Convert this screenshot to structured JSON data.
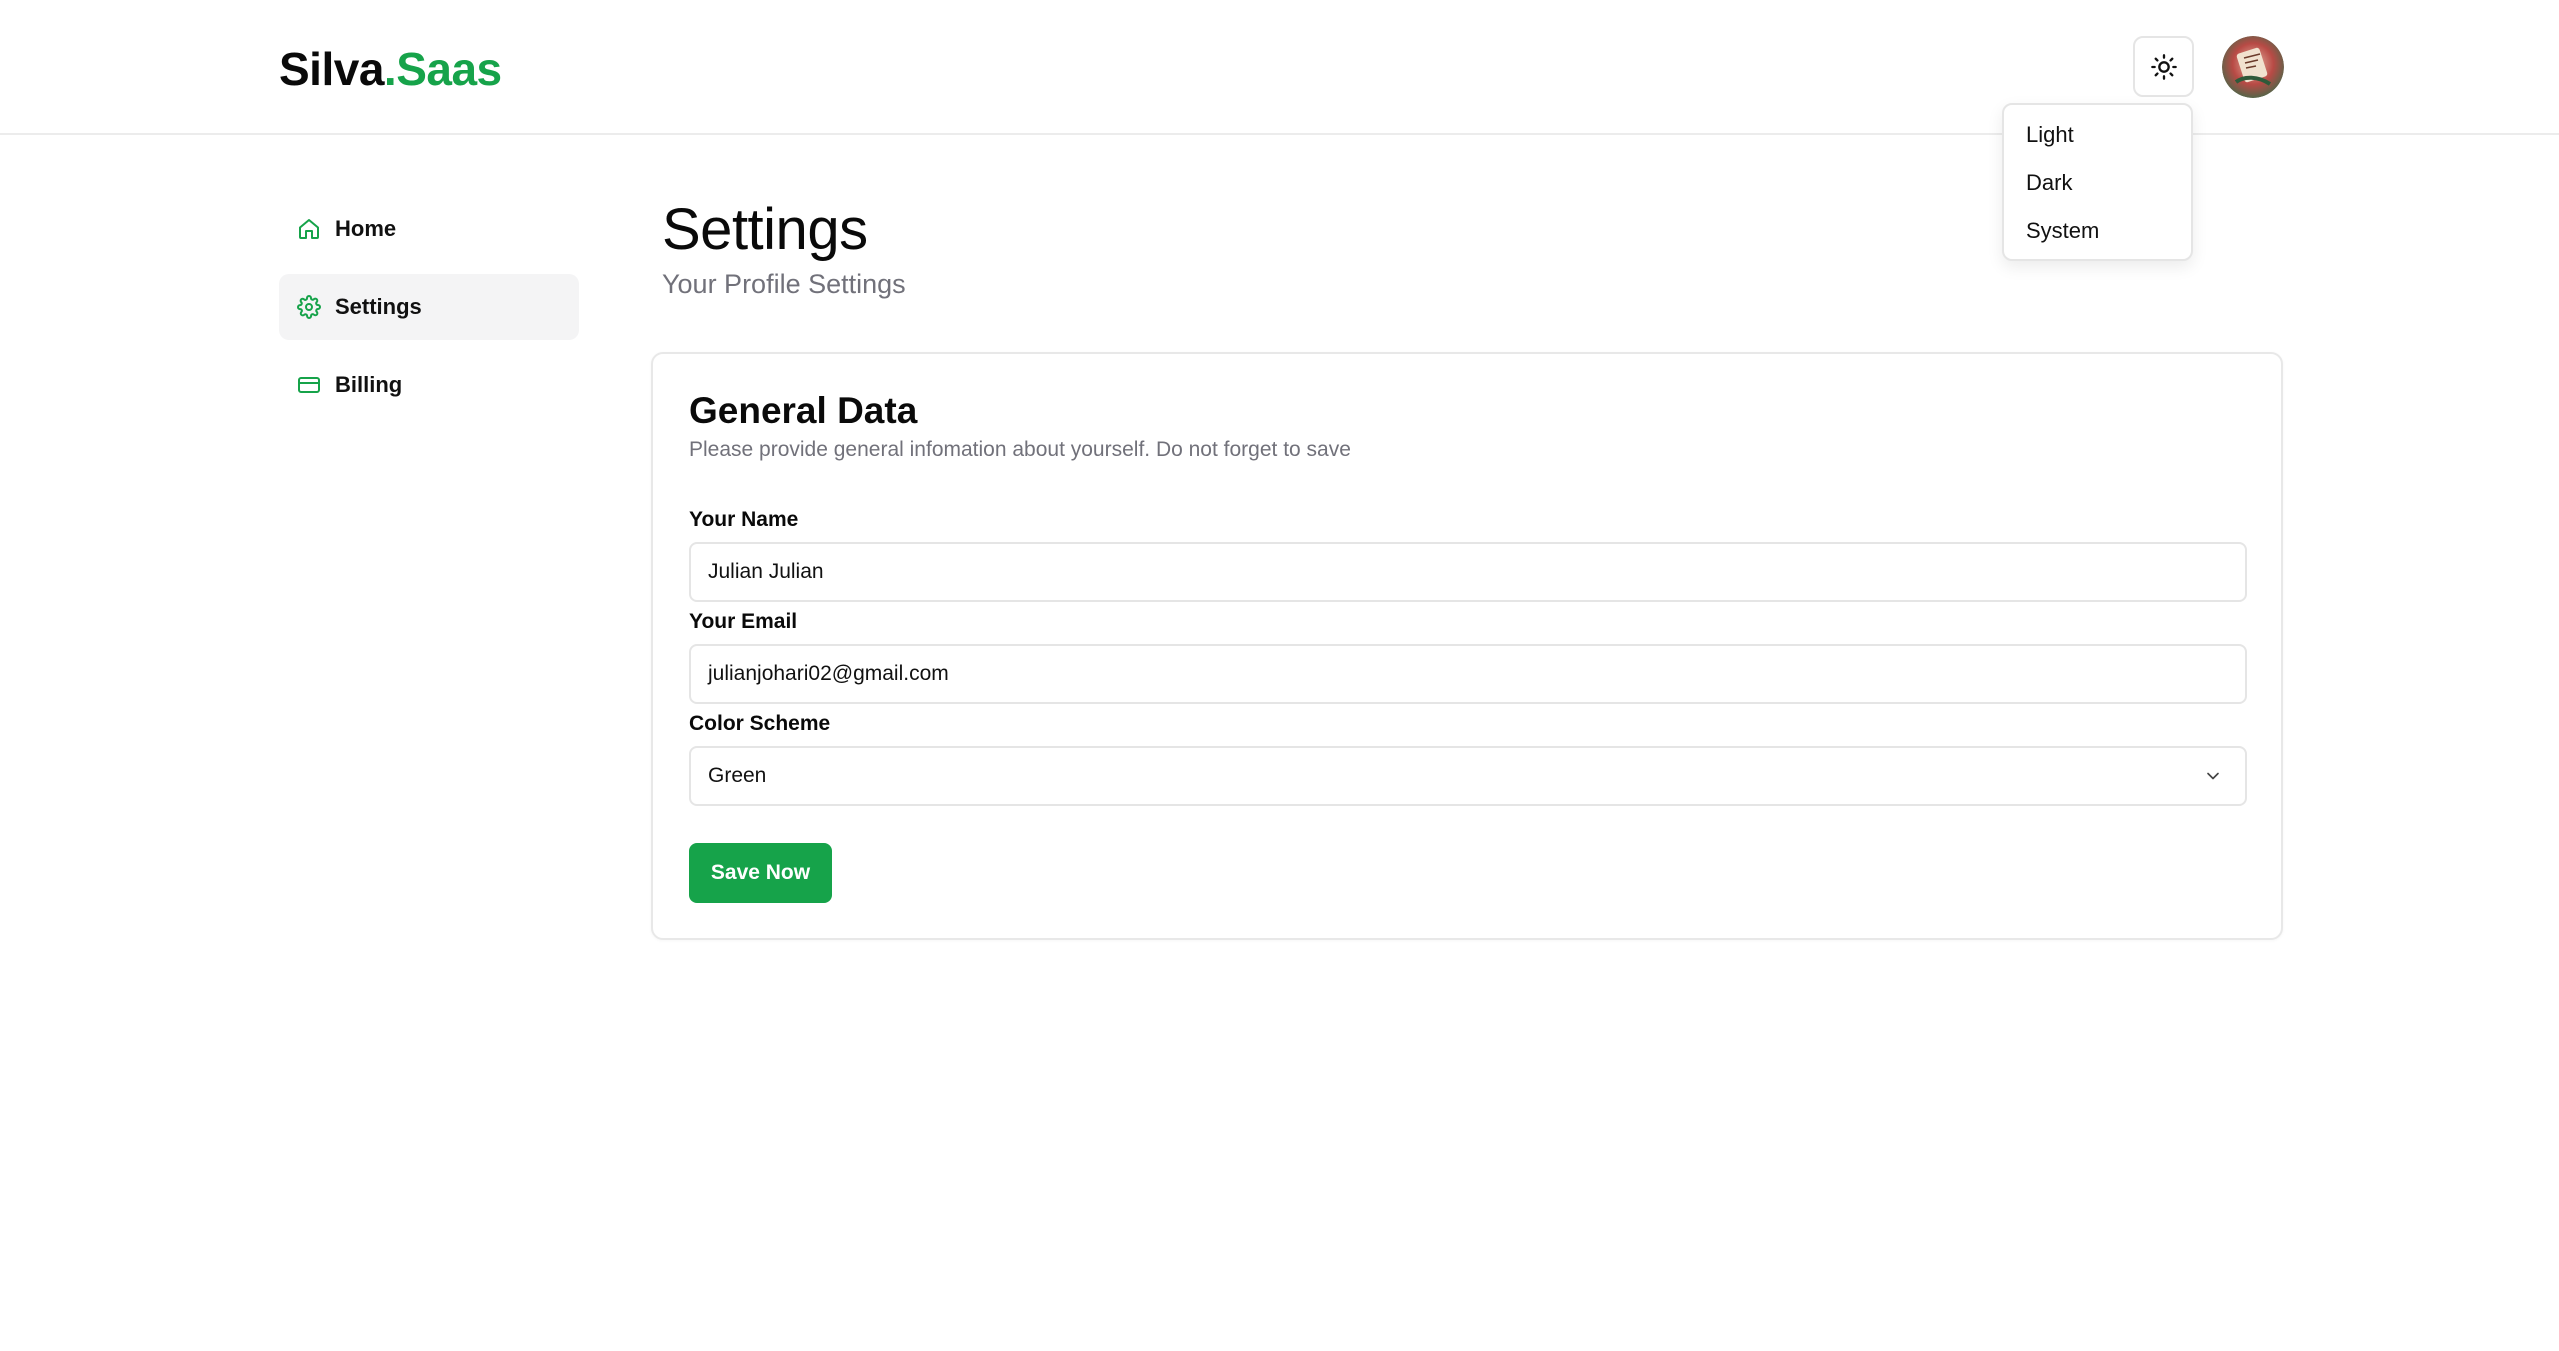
{
  "header": {
    "logo_primary": "Silva",
    "logo_accent": ".Saas",
    "theme_button_icon": "sun-icon",
    "avatar_alt": "avatar"
  },
  "theme_menu": {
    "items": [
      {
        "label": "Light"
      },
      {
        "label": "Dark"
      },
      {
        "label": "System"
      }
    ]
  },
  "sidebar": {
    "items": [
      {
        "label": "Home",
        "icon": "home-icon",
        "active": false
      },
      {
        "label": "Settings",
        "icon": "gear-icon",
        "active": true
      },
      {
        "label": "Billing",
        "icon": "credit-card-icon",
        "active": false
      }
    ]
  },
  "page": {
    "title": "Settings",
    "subtitle": "Your Profile Settings"
  },
  "card": {
    "title": "General Data",
    "description": "Please provide general infomation about yourself. Do not forget to save",
    "name_label": "Your Name",
    "name_value": "Julian Julian",
    "email_label": "Your Email",
    "email_value": "julianjohari02@gmail.com",
    "color_label": "Color Scheme",
    "color_value": "Green",
    "save_label": "Save Now"
  },
  "colors": {
    "accent": "#16a34a",
    "muted_text": "#71717a",
    "border": "#e5e5e5",
    "active_bg": "#f4f4f5"
  }
}
